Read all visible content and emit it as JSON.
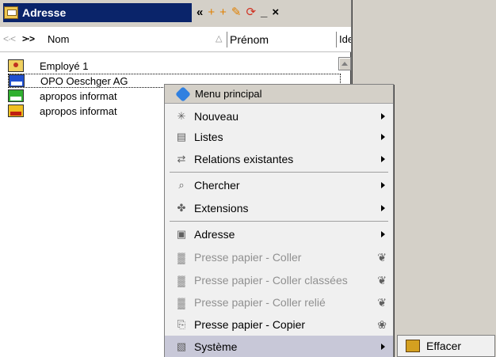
{
  "window": {
    "title": "Adresse"
  },
  "toolbar": {
    "collapse_label": "«",
    "new_icon": "+",
    "new_list_icon": "+",
    "search_glyph": "✎",
    "refresh_glyph": "⟳",
    "minimize_label": "_",
    "close_label": "×"
  },
  "header": {
    "nav_back": "<·<",
    "nav_forward": ">·>",
    "columns": [
      "Nom",
      "Prénom",
      "Ide"
    ],
    "sort_indicator": "△"
  },
  "rows": [
    {
      "label": "Employé 1",
      "icon": "employee-icon"
    },
    {
      "label": "OPO Oeschger AG",
      "icon": "company-icon"
    },
    {
      "label": "apropos informat",
      "icon": "company-green-icon"
    },
    {
      "label": "apropos informat",
      "icon": "company-yellow-icon"
    }
  ],
  "context_menu": {
    "header": "Menu principal",
    "items": [
      {
        "label": "Nouveau",
        "icon": "✳",
        "submenu": true,
        "disabled": false
      },
      {
        "label": "Listes",
        "icon": "▤",
        "submenu": true,
        "disabled": false
      },
      {
        "label": "Relations existantes",
        "icon": "⇄",
        "submenu": true,
        "disabled": false
      },
      {
        "label": "Chercher",
        "icon": "⌕",
        "submenu": true,
        "disabled": false
      },
      {
        "label": "Extensions",
        "icon": "✤",
        "submenu": true,
        "disabled": false
      },
      {
        "label": "Adresse",
        "icon": "▣",
        "submenu": true,
        "disabled": false
      },
      {
        "label": "Presse papier - Coller",
        "icon": "▓",
        "tail": "❦",
        "disabled": true
      },
      {
        "label": "Presse papier - Coller classées",
        "icon": "▓",
        "tail": "❦",
        "disabled": true
      },
      {
        "label": "Presse papier - Coller relié",
        "icon": "▓",
        "tail": "❦",
        "disabled": true
      },
      {
        "label": "Presse papier - Copier",
        "icon": "⎘",
        "tail": "❀",
        "disabled": false
      },
      {
        "label": "Système",
        "icon": "▧",
        "submenu": true,
        "disabled": false,
        "highlight": true
      }
    ]
  },
  "submenu": {
    "items": [
      {
        "label": "Effacer"
      }
    ]
  }
}
